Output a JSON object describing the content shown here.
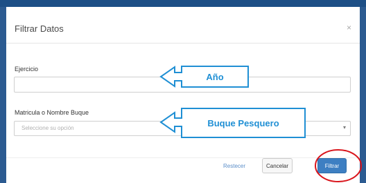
{
  "dialog": {
    "title": "Filtrar Datos",
    "close_glyph": "×"
  },
  "form": {
    "ejercicio_label": "Ejercicio",
    "ejercicio_value": "",
    "matricula_label": "Matricula o Nombre Buque",
    "matricula_placeholder": "Seleccione su opción",
    "select_arrow_glyph": "▾"
  },
  "footer": {
    "reset_label": "Restecer",
    "cancel_label": "Cancelar",
    "filter_label": "Filtrar"
  },
  "annotations": {
    "anio": "Año",
    "buque": "Buque Pesquero",
    "callout_color": "#1f8fd4",
    "highlight_color": "#d9141b"
  },
  "colors": {
    "header_bar": "#1d4f86",
    "primary_button": "#3d7fc2"
  }
}
